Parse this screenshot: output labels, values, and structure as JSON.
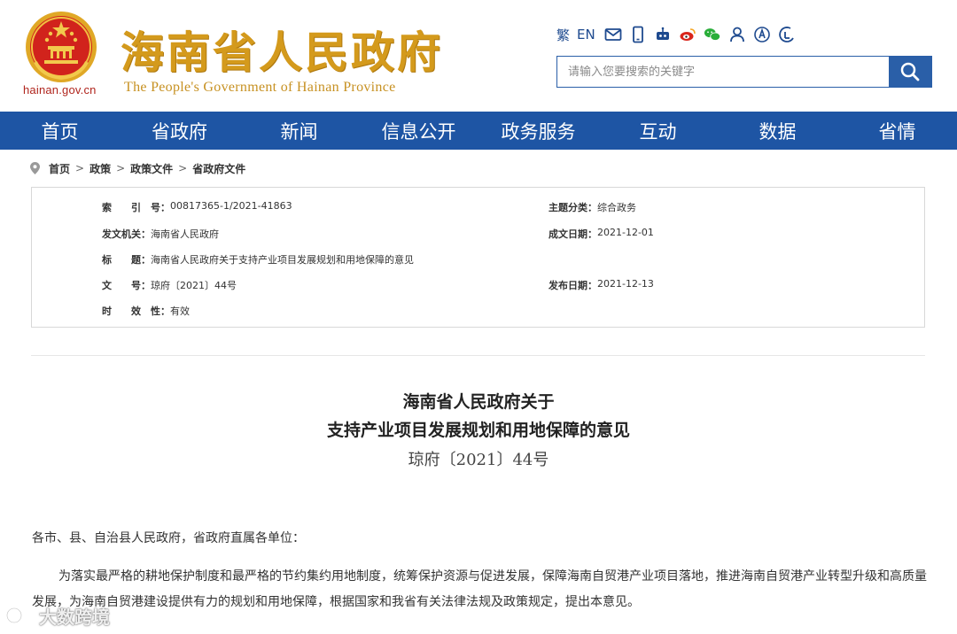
{
  "header": {
    "site_url": "hainan.gov.cn",
    "site_title": "海南省人民政府",
    "site_subtitle": "The People's Government  of Hainan Province",
    "tools": {
      "traditional_label": "繁",
      "english_label": "EN"
    },
    "search": {
      "placeholder": "请输入您要搜索的关键字"
    }
  },
  "nav": {
    "items": [
      "首页",
      "省政府",
      "新闻",
      "信息公开",
      "政务服务",
      "互动",
      "数据",
      "省情"
    ]
  },
  "breadcrumb": {
    "items": [
      "首页",
      "政策",
      "政策文件",
      "省政府文件"
    ],
    "separator": ">"
  },
  "info": {
    "index_label": "索　　引　号：",
    "index_value": "00817365-1/2021-41863",
    "category_label": "主题分类：",
    "category_value": "综合政务",
    "issuer_label": "发文机关：",
    "issuer_value": "海南省人民政府",
    "created_label": "成文日期：",
    "created_value": "2021-12-01",
    "title_label": "标　　题：",
    "title_value": "海南省人民政府关于支持产业项目发展规划和用地保障的意见",
    "docno_label": "文　　号：",
    "docno_value": "琼府〔2021〕44号",
    "published_label": "发布日期：",
    "published_value": "2021-12-13",
    "validity_label": "时　　效　性：",
    "validity_value": "有效"
  },
  "article": {
    "title_line1": "海南省人民政府关于",
    "title_line2": "支持产业项目发展规划和用地保障的意见",
    "doc_number": "琼府〔2021〕44号",
    "salutation": "各市、县、自治县人民政府，省政府直属各单位：",
    "paragraph1": "为落实最严格的耕地保护制度和最严格的节约集约用地制度，统筹保护资源与促进发展，保障海南自贸港产业项目落地，推进海南自贸港产业转型升级和高质量发展，为海南自贸港建设提供有力的规划和用地保障，根据国家和我省有关法律法规及政策规定，提出本意见。"
  },
  "watermark": {
    "text": "大数跨境"
  },
  "colors": {
    "brand_blue": "#1e55a4",
    "title_gold": "#d49a1c",
    "emblem_red": "#c8201c"
  }
}
